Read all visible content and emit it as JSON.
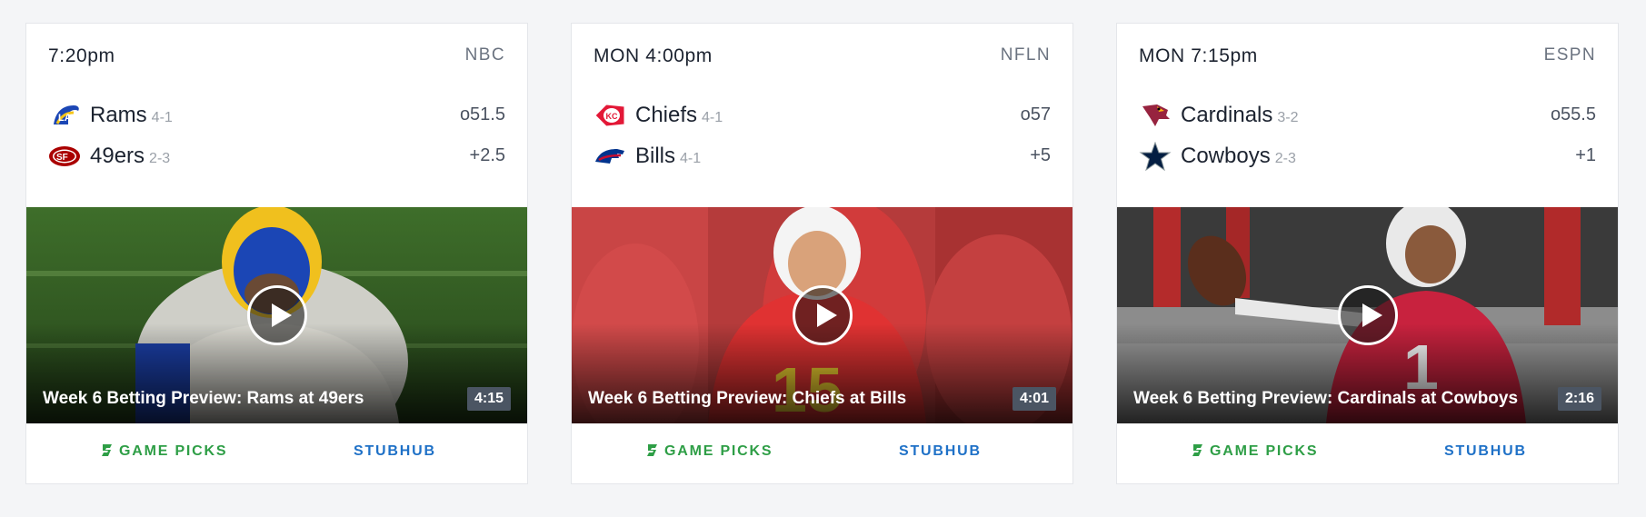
{
  "colors": {
    "picks_green": "#2e9e46",
    "stubhub_blue": "#1f71c7",
    "duration_badge": "#4b5563"
  },
  "games": [
    {
      "time": "7:20pm",
      "network": "NBC",
      "teams": [
        {
          "name": "Rams",
          "record": "4-1",
          "odds": "o51.5",
          "logo": "rams-logo"
        },
        {
          "name": "49ers",
          "record": "2-3",
          "odds": "+2.5",
          "logo": "49ers-logo"
        }
      ],
      "video": {
        "title": "Week 6 Betting Preview: Rams at 49ers",
        "duration": "4:15"
      },
      "links": {
        "picks": "GAME PICKS",
        "stubhub": "STUBHUB"
      }
    },
    {
      "time": "MON 4:00pm",
      "network": "NFLN",
      "teams": [
        {
          "name": "Chiefs",
          "record": "4-1",
          "odds": "o57",
          "logo": "chiefs-logo"
        },
        {
          "name": "Bills",
          "record": "4-1",
          "odds": "+5",
          "logo": "bills-logo"
        }
      ],
      "video": {
        "title": "Week 6 Betting Preview: Chiefs at Bills",
        "duration": "4:01"
      },
      "links": {
        "picks": "GAME PICKS",
        "stubhub": "STUBHUB"
      }
    },
    {
      "time": "MON 7:15pm",
      "network": "ESPN",
      "teams": [
        {
          "name": "Cardinals",
          "record": "3-2",
          "odds": "o55.5",
          "logo": "cardinals-logo"
        },
        {
          "name": "Cowboys",
          "record": "2-3",
          "odds": "+1",
          "logo": "cowboys-logo"
        }
      ],
      "video": {
        "title": "Week 6 Betting Preview: Cardinals at Cowboys",
        "duration": "2:16"
      },
      "links": {
        "picks": "GAME PICKS",
        "stubhub": "STUBHUB"
      }
    }
  ]
}
